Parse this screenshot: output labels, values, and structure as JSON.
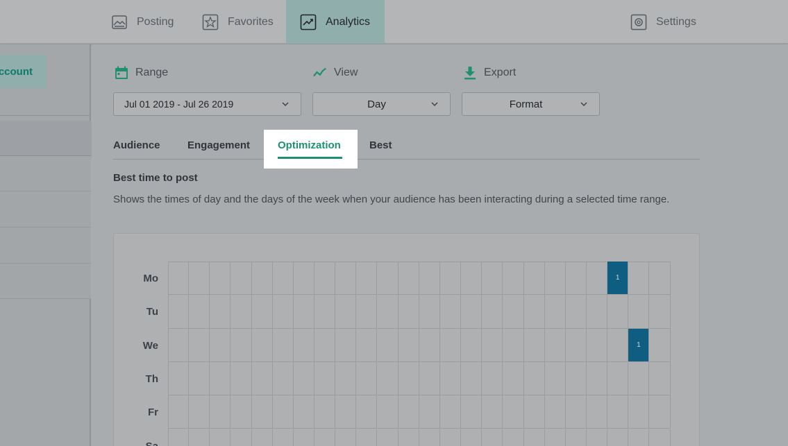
{
  "nav": {
    "posting": "Posting",
    "favorites": "Favorites",
    "analytics": "Analytics",
    "settings": "Settings"
  },
  "sidebar": {
    "account_label": "ccount"
  },
  "controls": {
    "range_label": "Range",
    "view_label": "View",
    "export_label": "Export",
    "range_value": "Jul 01 2019 - Jul 26 2019",
    "view_value": "Day",
    "export_value": "Format"
  },
  "tabs": {
    "audience": "Audience",
    "engagement": "Engagement",
    "optimization": "Optimization",
    "best": "Best"
  },
  "section": {
    "title": "Best time to post",
    "description": "Shows the times of day and the days of the week when your audience has been interacting during a selected time range."
  },
  "heatmap": {
    "days": [
      "Mo",
      "Tu",
      "We",
      "Th",
      "Fr",
      "Sa"
    ],
    "columns": 24,
    "cells": [
      {
        "day": "Mo",
        "slot": 21,
        "value": "1"
      },
      {
        "day": "We",
        "slot": 22,
        "value": "1"
      }
    ],
    "fill_color": "#0f5d80"
  },
  "colors": {
    "accent": "#1e9070",
    "active_nav_bg": "#8faeac"
  }
}
